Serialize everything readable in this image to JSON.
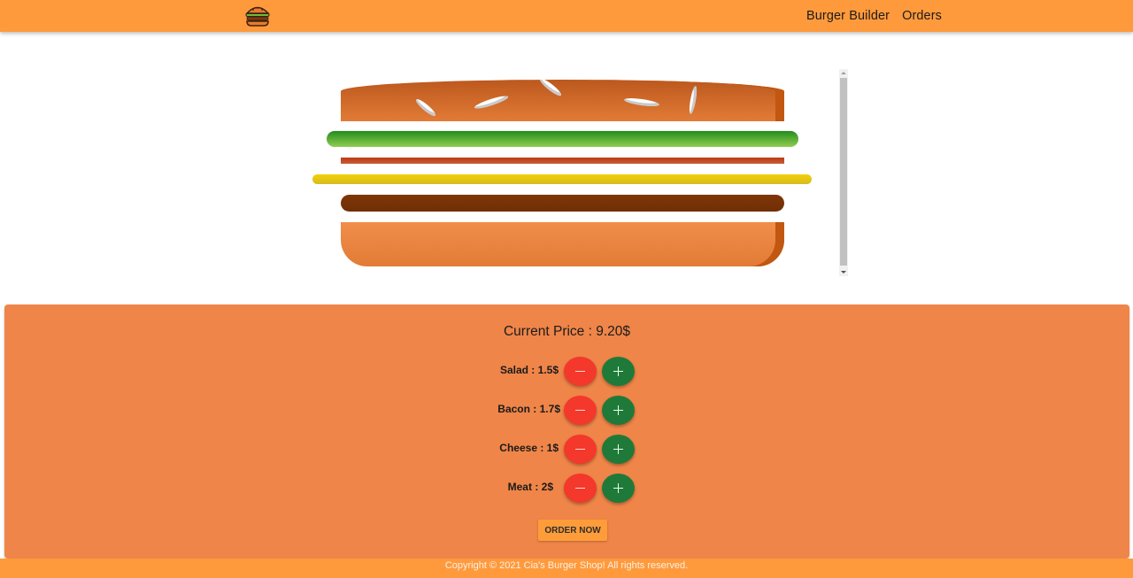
{
  "header": {
    "logo_icon": "burger-logo-icon",
    "nav": [
      {
        "label": "Burger Builder"
      },
      {
        "label": "Orders"
      }
    ]
  },
  "burger": {
    "layers": [
      "bread-top",
      "salad",
      "bacon",
      "cheese",
      "meat",
      "bread-bottom"
    ]
  },
  "controls": {
    "price_text": "Current Price : 9.20$",
    "ingredients": [
      {
        "label": "Salad : 1.5$"
      },
      {
        "label": "Bacon : 1.7$"
      },
      {
        "label": "Cheese : 1$"
      },
      {
        "label": "Meat : 2$"
      }
    ],
    "order_label": "ORDER NOW"
  },
  "footer": {
    "text": "Copyright © 2021  Cia's Burger Shop! All rights reserved."
  },
  "colors": {
    "header": "#ff9a3c",
    "panel": "#ef8548",
    "less_button": "#f4382b",
    "more_button": "#1f7a3a"
  }
}
